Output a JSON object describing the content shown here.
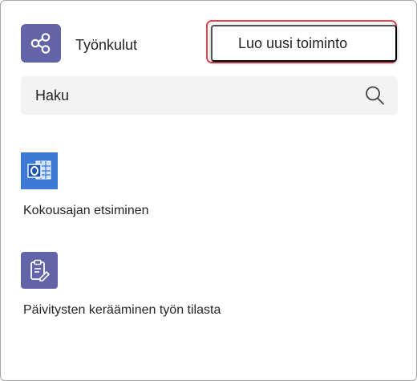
{
  "header": {
    "app_icon": "share-nodes-icon",
    "title": "Työnkulut",
    "new_action_label": "Luo uusi toiminto",
    "highlight_color": "#e0434b",
    "accent_color": "#6264a7"
  },
  "search": {
    "placeholder": "Haku",
    "value": "",
    "icon": "search-icon"
  },
  "workflows": [
    {
      "label": "Kokousajan etsiminen",
      "icon": "outlook-calendar-icon",
      "icon_color": "#3c7ad6"
    },
    {
      "label": "Päivitysten kerääminen työn tilasta",
      "icon": "clipboard-edit-icon",
      "icon_color": "#6264a7"
    }
  ]
}
